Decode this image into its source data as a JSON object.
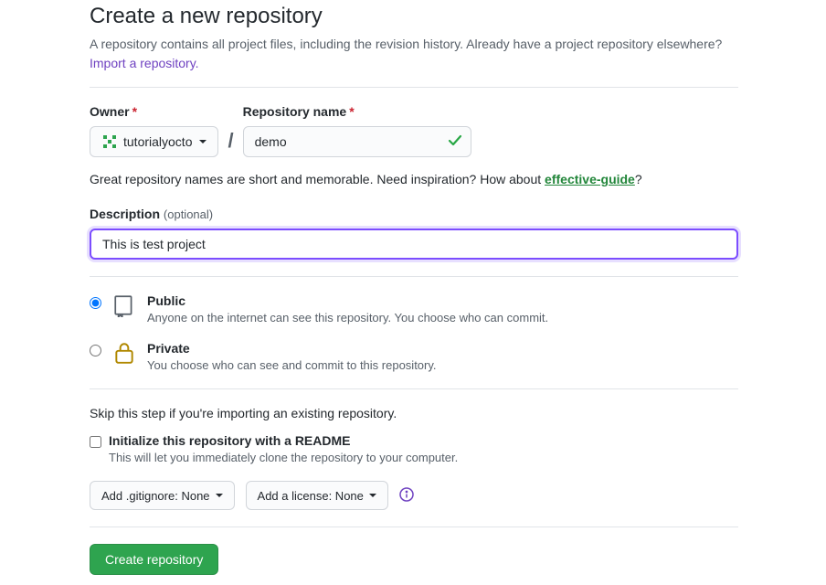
{
  "header": {
    "title": "Create a new repository",
    "subtitle": "A repository contains all project files, including the revision history. Already have a project repository elsewhere?",
    "import_link": "Import a repository."
  },
  "owner": {
    "label": "Owner",
    "selected": "tutorialyocto"
  },
  "repo": {
    "label": "Repository name",
    "value": "demo"
  },
  "hint": {
    "prefix": "Great repository names are short and memorable. Need inspiration? How about ",
    "suggestion": "effective-guide",
    "suffix": "?"
  },
  "description": {
    "label": "Description",
    "optional": "(optional)",
    "value": "This is test project"
  },
  "visibility": {
    "public": {
      "title": "Public",
      "sub": "Anyone on the internet can see this repository. You choose who can commit."
    },
    "private": {
      "title": "Private",
      "sub": "You choose who can see and commit to this repository."
    }
  },
  "init": {
    "skip_note": "Skip this step if you're importing an existing repository.",
    "readme_label": "Initialize this repository with a README",
    "readme_sub": "This will let you immediately clone the repository to your computer."
  },
  "dropdowns": {
    "gitignore": "Add .gitignore: None",
    "license": "Add a license: None"
  },
  "submit": {
    "label": "Create repository"
  }
}
